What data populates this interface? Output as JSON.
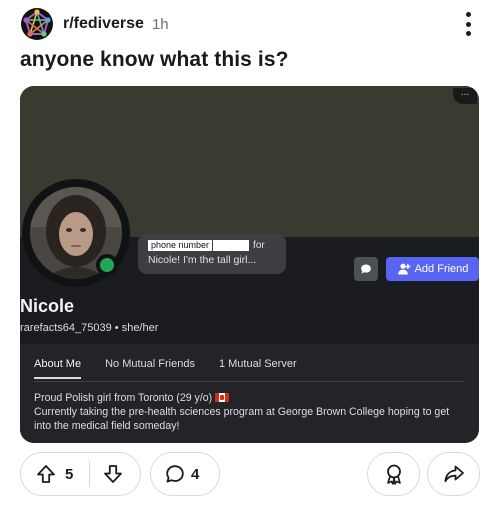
{
  "post": {
    "subreddit": "r/fediverse",
    "age": "1h",
    "title": "anyone know what this is?"
  },
  "card": {
    "corner_menu": "...",
    "bubble_redacted": "phone number",
    "bubble_for": "for",
    "bubble_line2": "Nicole! I'm the tall girl...",
    "add_friend_label": "Add Friend",
    "name": "Nicole",
    "handle": "rarefacts64_75039 • she/her",
    "tabs": [
      "About Me",
      "No Mutual Friends",
      "1 Mutual Server"
    ],
    "bio_line1": "Proud Polish girl from Toronto (29 y/o)",
    "bio_line2": "Currently taking the pre-health sciences program at George Brown College hoping to get into the medical field someday!"
  },
  "actions": {
    "upvote_count": "5",
    "comment_count": "4"
  },
  "icons": {
    "subreddit": "fediverse-logo-icon",
    "more": "kebab-menu-icon",
    "message": "chat-bubble-icon",
    "add_friend": "person-add-icon",
    "upvote": "arrow-up-icon",
    "downvote": "arrow-down-icon",
    "comment": "comment-bubble-icon",
    "award": "award-ribbon-icon",
    "share": "share-arrow-icon"
  },
  "colors": {
    "discord_blurple": "#5865f2",
    "online_green": "#23a55a",
    "card_dark": "#1b1c20",
    "banner": "#3a3a30"
  }
}
